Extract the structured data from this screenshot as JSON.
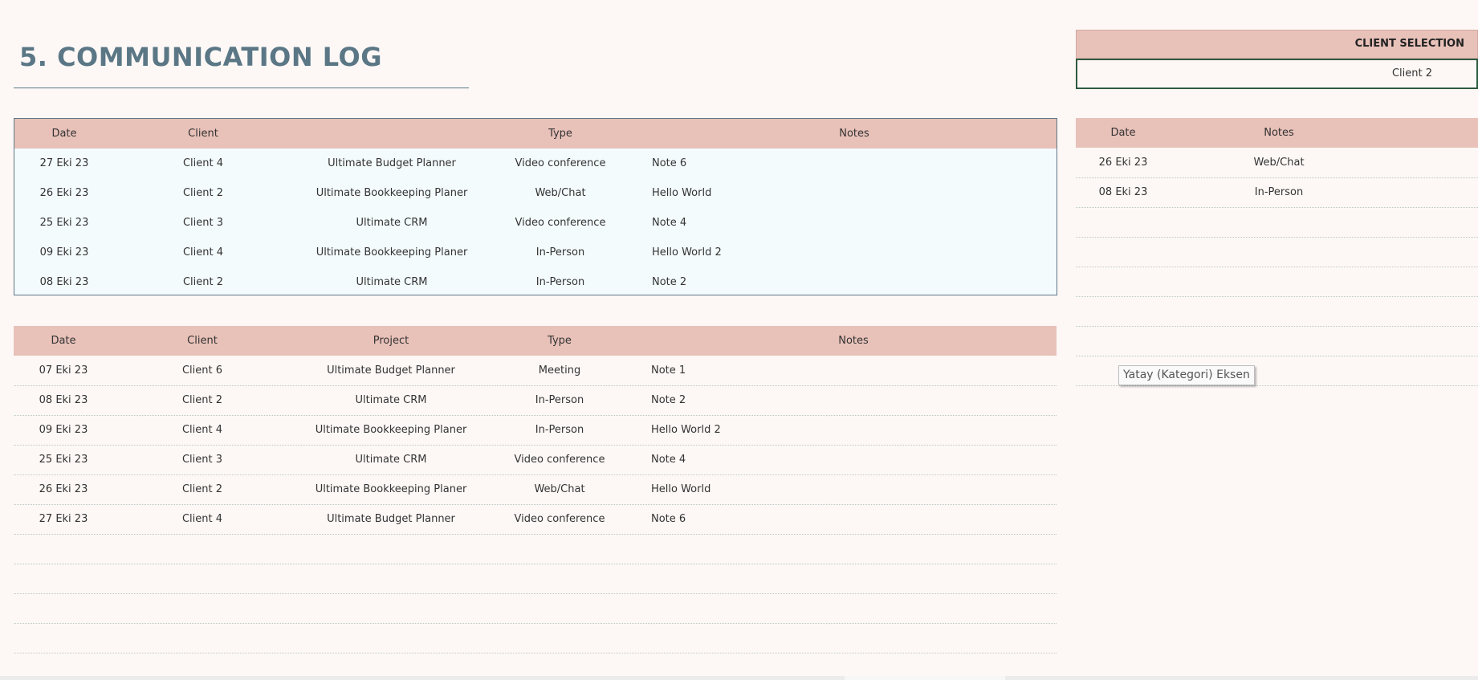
{
  "page": {
    "title": "5. COMMUNICATION LOG"
  },
  "client_selection": {
    "header": "CLIENT SELECTION",
    "value": "Client 2"
  },
  "recent_table": {
    "headers": [
      "Date",
      "Client",
      "Type",
      "Notes"
    ],
    "rows": [
      [
        "27 Eki 23",
        "Client 4",
        "Ultimate Budget Planner",
        "Video conference",
        "Note 6"
      ],
      [
        "26 Eki 23",
        "Client 2",
        "Ultimate Bookkeeping Planer",
        "Web/Chat",
        "Hello World"
      ],
      [
        "25 Eki 23",
        "Client 3",
        "Ultimate CRM",
        "Video conference",
        "Note 4"
      ],
      [
        "09 Eki 23",
        "Client 4",
        "Ultimate Bookkeeping Planer",
        "In-Person",
        "Hello World 2"
      ],
      [
        "08 Eki 23",
        "Client 2",
        "Ultimate CRM",
        "In-Person",
        "Note 2"
      ]
    ]
  },
  "log_table": {
    "headers": [
      "Date",
      "Client",
      "Project",
      "Type",
      "Notes"
    ],
    "rows": [
      [
        "07 Eki 23",
        "Client 6",
        "Ultimate Budget Planner",
        "Meeting",
        "Note 1"
      ],
      [
        "08 Eki 23",
        "Client 2",
        "Ultimate CRM",
        "In-Person",
        "Note 2"
      ],
      [
        "09 Eki 23",
        "Client 4",
        "Ultimate Bookkeeping Planer",
        "In-Person",
        "Hello World 2"
      ],
      [
        "25 Eki 23",
        "Client 3",
        "Ultimate CRM",
        "Video conference",
        "Note 4"
      ],
      [
        "26 Eki 23",
        "Client 2",
        "Ultimate Bookkeeping Planer",
        "Web/Chat",
        "Hello World"
      ],
      [
        "27 Eki 23",
        "Client 4",
        "Ultimate Budget Planner",
        "Video conference",
        "Note 6"
      ]
    ]
  },
  "client_table": {
    "headers": [
      "Date",
      "Notes"
    ],
    "rows": [
      [
        "26 Eki 23",
        "Web/Chat"
      ],
      [
        "08 Eki 23",
        "In-Person"
      ]
    ]
  },
  "tooltip": {
    "text": "Yatay (Kategori) Eksen"
  }
}
